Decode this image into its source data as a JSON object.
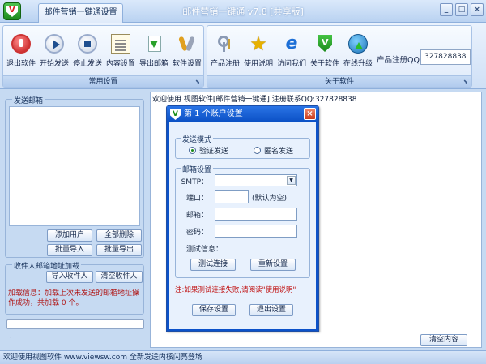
{
  "window": {
    "title": "邮件营销一键通 v7.8 [共享版]",
    "tab": "邮件营销一键通设置",
    "controls": [
      "_",
      "□",
      "×"
    ]
  },
  "ribbon": {
    "common_group": {
      "label": "常用设置",
      "items": [
        {
          "label": "退出软件",
          "icon": "power-icon"
        },
        {
          "label": "开始发送",
          "icon": "play-icon"
        },
        {
          "label": "停止发送",
          "icon": "stop-icon"
        },
        {
          "label": "内容设置",
          "icon": "notepad-icon"
        },
        {
          "label": "导出邮箱",
          "icon": "export-icon"
        },
        {
          "label": "软件设置",
          "icon": "tools-icon"
        }
      ]
    },
    "about_group": {
      "label": "关于软件",
      "items": [
        {
          "label": "产品注册",
          "icon": "keys-icon"
        },
        {
          "label": "使用说明",
          "icon": "star-icon"
        },
        {
          "label": "访问我们",
          "icon": "ie-icon"
        },
        {
          "label": "关于软件",
          "icon": "shield-icon"
        },
        {
          "label": "在线升级",
          "icon": "globe-icon"
        }
      ]
    },
    "qq_label": "产品注册QQ:",
    "qq_value": "327828838"
  },
  "left": {
    "send_legend": "发送邮箱",
    "btn_add_user": "添加用户",
    "btn_delete_all": "全部删除",
    "btn_batch_import": "批量导入",
    "btn_batch_export": "批量导出",
    "recipient_legend": "收件人邮箱地址加载",
    "btn_import_recipient": "导入收件人",
    "btn_clear_recipient": "清空收件人",
    "load_info": "加载信息：加载上次未发送的邮箱地址操作成功，共加载 0 个。",
    "progress": 0,
    "status_dot": "."
  },
  "right": {
    "welcome": "欢迎使用 视图软件[邮件营销一键通] 注册联系QQ:327828838",
    "clear_btn": "清空内容"
  },
  "dialog": {
    "title": "第 1 个账户设置",
    "close": "×",
    "mode_legend": "发送模式",
    "radio_auth": "验证发送",
    "radio_anon": "匿名发送",
    "mail_legend": "邮箱设置",
    "smtp_label": "SMTP：",
    "smtp_value": "",
    "port_label": "端口：",
    "port_value": "",
    "port_hint": "(默认为空)",
    "email_label": "邮箱：",
    "email_value": "",
    "password_label": "密码：",
    "password_value": "",
    "test_info": "测试信息：.",
    "btn_test": "测试连接",
    "btn_reset": "重新设置",
    "warning": "注:如果测试连接失败,请阅读\"使用说明\"",
    "btn_save": "保存设置",
    "btn_exit": "退出设置"
  },
  "statusbar": {
    "text": "欢迎使用视图软件 www.viewsw.com 全新发送内核闪亮登场"
  }
}
